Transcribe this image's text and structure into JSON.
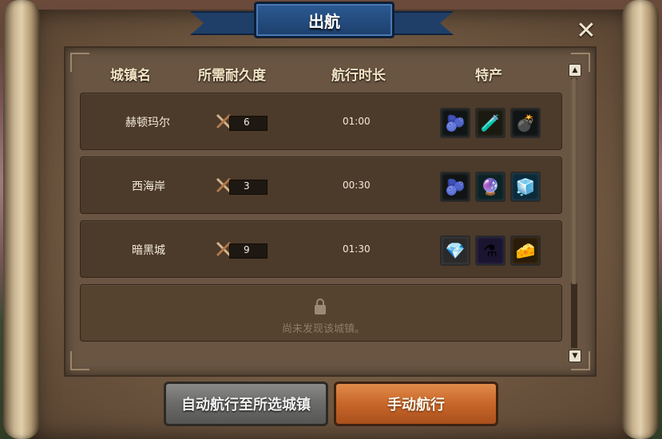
{
  "title": "出航",
  "close_icon": "close-icon",
  "headers": {
    "town": "城镇名",
    "durability": "所需耐久度",
    "duration": "航行时长",
    "specialty": "特产"
  },
  "rows": [
    {
      "town": "赫顿玛尔",
      "durability": "6",
      "duration": "01:00",
      "specialties": [
        "purple-berry-icon",
        "potion-brush-icon",
        "bomb-flask-icon"
      ]
    },
    {
      "town": "西海岸",
      "durability": "3",
      "duration": "00:30",
      "specialties": [
        "purple-berry-icon",
        "dark-orb-icon",
        "blue-jelly-icon"
      ]
    },
    {
      "town": "暗黑城",
      "durability": "9",
      "duration": "01:30",
      "specialties": [
        "purple-crystal-icon",
        "purple-potion-icon",
        "cheese-icon"
      ]
    }
  ],
  "locked_row": {
    "text": "尚未发现该城镇。"
  },
  "buttons": {
    "auto": "自动航行至所选城镇",
    "manual": "手动航行"
  },
  "colors": {
    "title_banner": "#1f3f68",
    "manual_button": "#c8662a",
    "auto_button": "#6a6a68"
  }
}
